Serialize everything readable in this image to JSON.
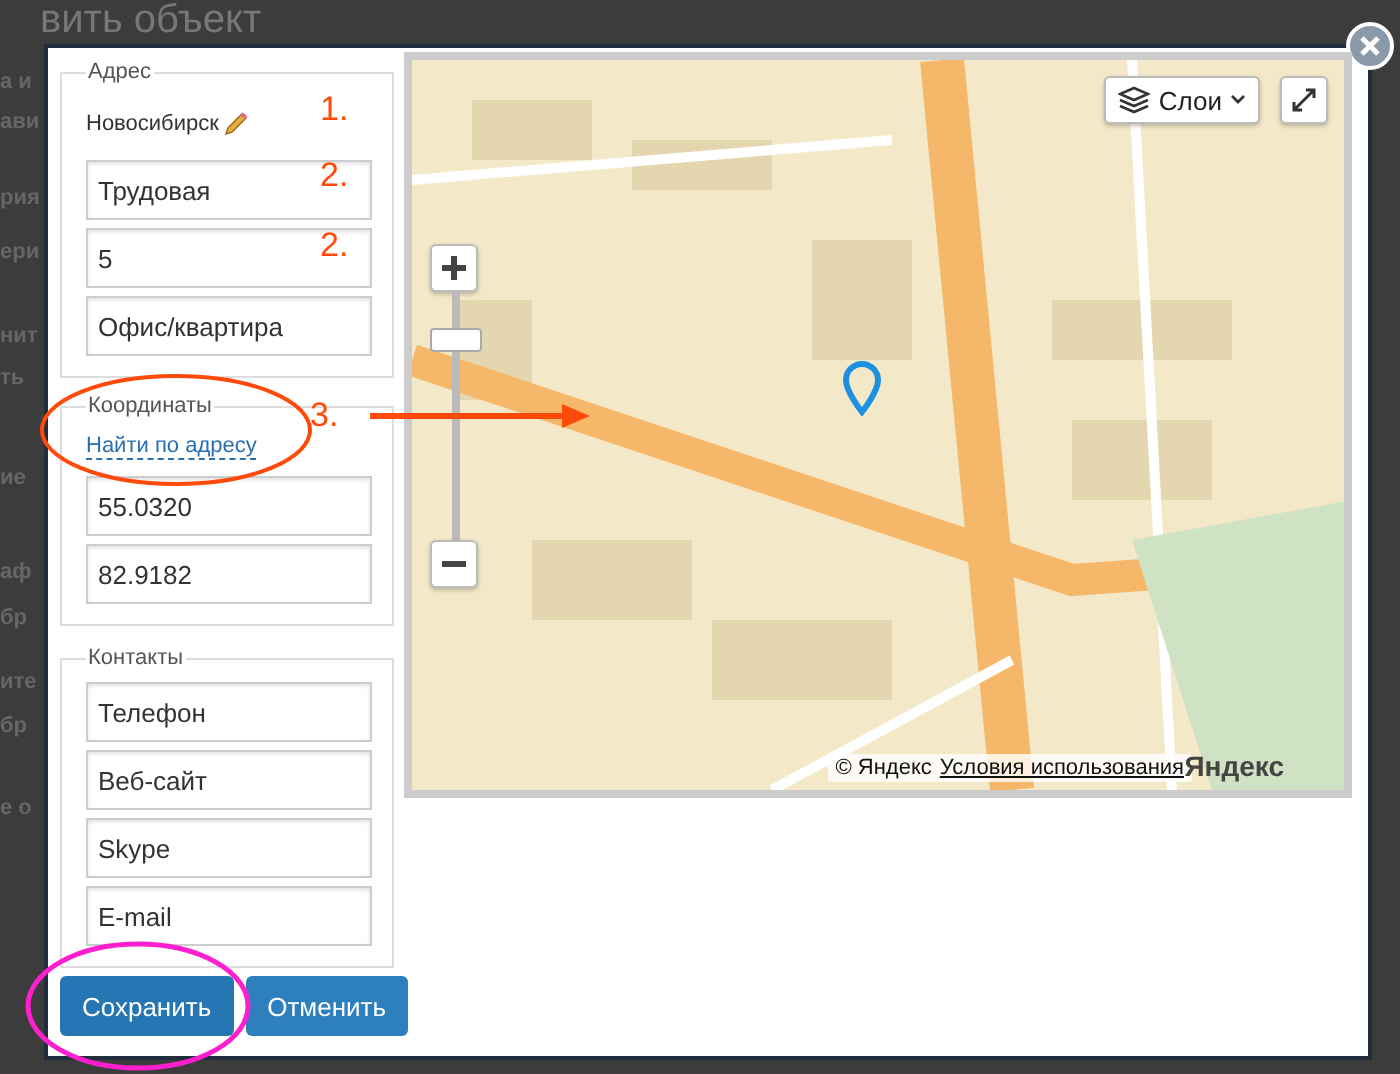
{
  "page": {
    "title": "вить объект",
    "fragments": [
      "а и",
      "ави",
      "рия",
      "ери",
      "нит",
      "ть",
      "ие",
      "аф",
      "бр",
      "ите",
      "бр",
      "е о"
    ]
  },
  "dialog": {
    "address": {
      "legend": "Адрес",
      "city": "Новосибирск",
      "fields": [
        {
          "value": "Трудовая"
        },
        {
          "value": "5"
        },
        {
          "placeholder": "Офис/квартира"
        }
      ]
    },
    "coordinates": {
      "legend": "Координаты",
      "link": "Найти по адресу",
      "fields": [
        {
          "value": "55.0320"
        },
        {
          "value": "82.9182"
        }
      ]
    },
    "contacts": {
      "legend": "Контакты",
      "fields": [
        {
          "placeholder": "Телефон"
        },
        {
          "placeholder": "Веб-сайт"
        },
        {
          "placeholder": "Skype"
        },
        {
          "placeholder": "E-mail"
        }
      ]
    },
    "buttons": [
      {
        "label": "Сохранить",
        "kind": "primary"
      },
      {
        "label": "Отменить",
        "kind": "secondary"
      }
    ],
    "map": {
      "layers_button": "Слои",
      "zoom": {
        "level": 0.84
      },
      "copyright": "© Яндекс",
      "terms_link": "Условия использования",
      "logo": "Яндекс"
    }
  },
  "annotations": [
    {
      "text": "1."
    },
    {
      "text": "2."
    },
    {
      "text": "2."
    },
    {
      "text": "3."
    }
  ]
}
